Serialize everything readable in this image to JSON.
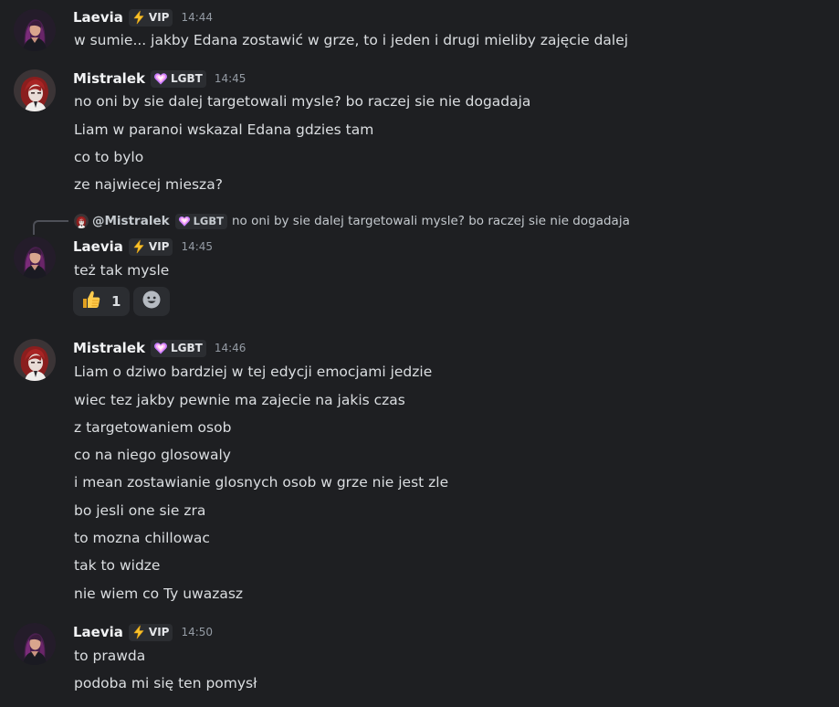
{
  "colors": {
    "background": "#1e1f22",
    "username": "#f2f3f5",
    "text": "#dbdee1",
    "timestamp": "#949ba4",
    "badge_bg": "#2b2d31"
  },
  "messages": [
    {
      "author": "Laevia",
      "badge": {
        "icon": "lightning-icon",
        "label": "VIP"
      },
      "timestamp": "14:44",
      "lines": [
        "w sumie... jakby Edana zostawić w grze, to i jeden i drugi mieliby zajęcie dalej"
      ]
    },
    {
      "author": "Mistralek",
      "badge": {
        "icon": "purple-heart-icon",
        "label": "LGBT"
      },
      "timestamp": "14:45",
      "lines": [
        "no oni by sie dalej targetowali mysle? bo raczej sie nie dogadaja",
        "Liam w paranoi wskazal Edana gdzies tam",
        "co to bylo",
        "ze najwiecej miesza?"
      ]
    },
    {
      "reply_to": {
        "author": "@Mistralek",
        "badge": {
          "icon": "purple-heart-icon",
          "label": "LGBT"
        },
        "text": "no oni by sie dalej targetowali mysle? bo raczej sie nie dogadaja"
      },
      "author": "Laevia",
      "badge": {
        "icon": "lightning-icon",
        "label": "VIP"
      },
      "timestamp": "14:45",
      "lines": [
        "też tak mysle"
      ],
      "reactions": [
        {
          "emoji": "thumbs-up-icon",
          "count": "1"
        }
      ]
    },
    {
      "author": "Mistralek",
      "badge": {
        "icon": "purple-heart-icon",
        "label": "LGBT"
      },
      "timestamp": "14:46",
      "lines": [
        "Liam o dziwo bardziej w tej edycji emocjami jedzie",
        "wiec tez jakby pewnie ma zajecie na jakis czas",
        "z targetowaniem osob",
        "co na niego glosowaly",
        "i mean zostawianie glosnych osob w grze nie jest zle",
        "bo jesli one sie zra",
        "to mozna chillowac",
        "tak to widze",
        "nie wiem co Ty uwazasz"
      ]
    },
    {
      "author": "Laevia",
      "badge": {
        "icon": "lightning-icon",
        "label": "VIP"
      },
      "timestamp": "14:50",
      "lines": [
        "to prawda",
        "podoba mi się ten pomysł"
      ]
    }
  ]
}
